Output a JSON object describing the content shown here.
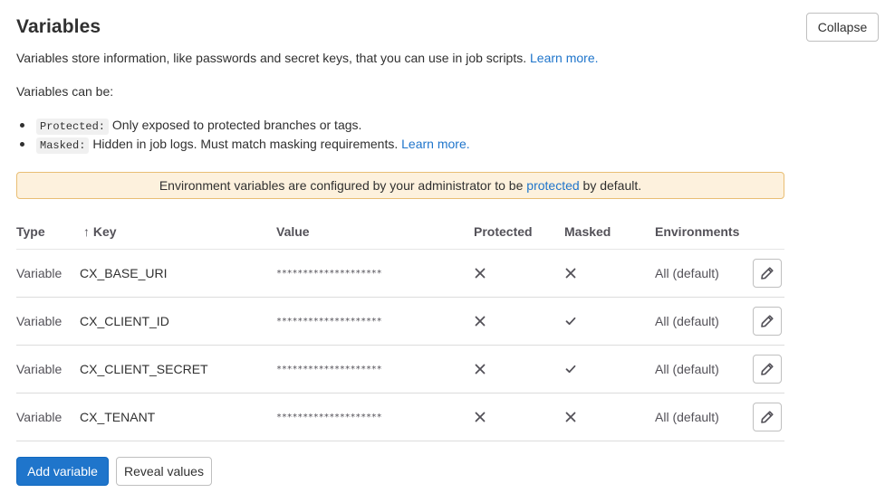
{
  "section": {
    "title": "Variables",
    "collapse_label": "Collapse",
    "description": "Variables store information, like passwords and secret keys, that you can use in job scripts.",
    "description_link": "Learn more.",
    "can_be": "Variables can be:",
    "bullets": [
      {
        "tag": "Protected:",
        "text": "Only exposed to protected branches or tags.",
        "link": ""
      },
      {
        "tag": "Masked:",
        "text": "Hidden in job logs. Must match masking requirements.",
        "link": "Learn more."
      }
    ]
  },
  "alert": {
    "before": "Environment variables are configured by your administrator to be",
    "link": "protected",
    "after": "by default."
  },
  "table": {
    "headers": {
      "type": "Type",
      "key_arrow": "↑",
      "key": "Key",
      "value": "Value",
      "protected": "Protected",
      "masked": "Masked",
      "environments": "Environments"
    },
    "rows": [
      {
        "type": "Variable",
        "key": "CX_BASE_URI",
        "value": "********************",
        "protected": false,
        "masked": false,
        "environment": "All (default)"
      },
      {
        "type": "Variable",
        "key": "CX_CLIENT_ID",
        "value": "********************",
        "protected": false,
        "masked": true,
        "environment": "All (default)"
      },
      {
        "type": "Variable",
        "key": "CX_CLIENT_SECRET",
        "value": "********************",
        "protected": false,
        "masked": true,
        "environment": "All (default)"
      },
      {
        "type": "Variable",
        "key": "CX_TENANT",
        "value": "********************",
        "protected": false,
        "masked": false,
        "environment": "All (default)"
      }
    ]
  },
  "actions": {
    "add_variable": "Add variable",
    "reveal_values": "Reveal values"
  },
  "icons": {
    "false_icon": "close-icon",
    "true_icon": "check-icon",
    "edit_icon": "pencil-icon"
  },
  "colors": {
    "link": "#1f75cb",
    "primary": "#1f75cb",
    "alert_bg": "#fdf1dd",
    "alert_border": "#e9be74"
  }
}
